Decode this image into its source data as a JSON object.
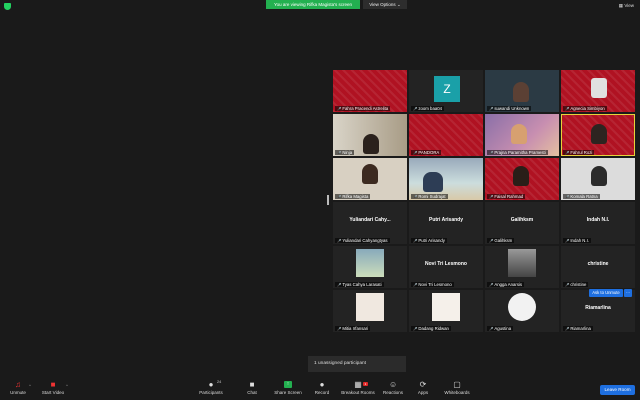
{
  "topbar": {
    "viewing_text": "You are viewing Rifka Magista's screen",
    "view_options": "View Options",
    "view": "View"
  },
  "tiles": [
    {
      "name": "Fahra Pracendi Astrelita"
    },
    {
      "name": "zoom baa04",
      "avatar": "Z"
    },
    {
      "name": "suwandi Unknown"
    },
    {
      "name": "Agnecia Simbiyon"
    },
    {
      "name": "Ninja"
    },
    {
      "name": "PANDORA"
    },
    {
      "name": "Prajna Paramitha Pramesti"
    },
    {
      "name": "Fahrul Rozi"
    },
    {
      "name": "Rifka Magista"
    },
    {
      "name": "Romi Sudrajat"
    },
    {
      "name": "Faisal Rahmad"
    },
    {
      "name": "Komala Ratna"
    },
    {
      "name": "Yuliandari Cahyangtyas",
      "big": "Yuliandari  Cahy..."
    },
    {
      "name": "Putri Arisandy",
      "big": "Putri Arisandy"
    },
    {
      "name": "Galihksm",
      "big": "Galihksm"
    },
    {
      "name": "Indah N.I.",
      "big": "Indah N.I."
    },
    {
      "name": "Tyas Cahya Larasati"
    },
    {
      "name": "Novi Tri Lesmono",
      "big": "Novi Tri Lesmono"
    },
    {
      "name": "Angga Anarsis"
    },
    {
      "name": "christine",
      "big": "christine"
    },
    {
      "name": "Mitia Irfansari"
    },
    {
      "name": "Dadang Ridwan"
    },
    {
      "name": "Agustina"
    },
    {
      "name": "Riamarlina",
      "big": "Riamarlina"
    }
  ],
  "unassigned": "1 unassigned participant",
  "ask_to_unmute": "Ask to Unmute",
  "ask_more": "···",
  "toolbar": {
    "unmute": "Unmute",
    "start_video": "Start Video",
    "participants": "Participants",
    "participants_count": "24",
    "chat": "Chat",
    "share_screen": "Share Screen",
    "record": "Record",
    "breakout_rooms": "Breakout Rooms",
    "breakout_badge": "1",
    "reactions": "Reactions",
    "apps": "Apps",
    "whiteboards": "Whiteboards",
    "leave": "Leave Room"
  }
}
